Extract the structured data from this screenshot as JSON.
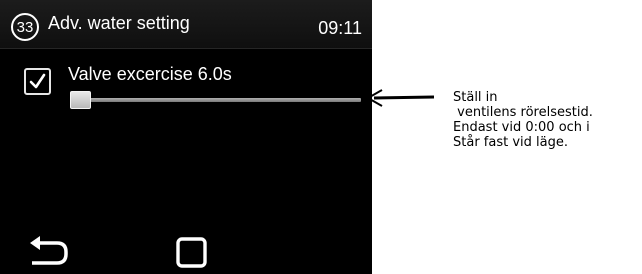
{
  "header": {
    "page_number": "33",
    "title": "Adv. water setting",
    "time": "09:11"
  },
  "setting": {
    "checked": true,
    "label": "Valve excercise",
    "value": "6.0s",
    "slider_fraction": 0.0
  },
  "nav": {
    "back_icon": "back-arrow-icon",
    "home_icon": "home-square-icon"
  },
  "annotation": {
    "lines": [
      "Ställ in",
      " ventilens rörelsestid.",
      "Endast vid 0:00 och i",
      "Står fast vid läge."
    ]
  },
  "colors": {
    "screen_bg": "#000000",
    "text": "#ffffff",
    "slider_track": "#9a9a9a",
    "slider_thumb": "#d0d0d0"
  }
}
